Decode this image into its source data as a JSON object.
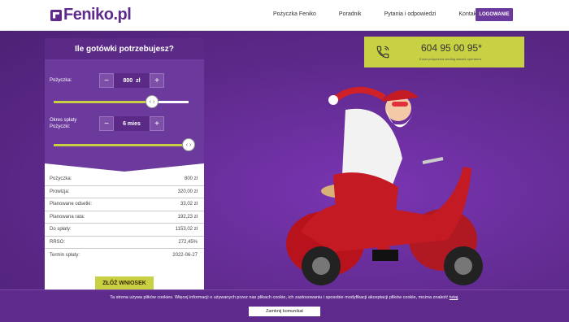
{
  "brand": {
    "logo_text": "Feniko.pl"
  },
  "nav": {
    "items": [
      "Pożyczka Feniko",
      "Poradnik",
      "Pytania i odpowiedzi",
      "Kontakt"
    ],
    "login_label": "LOGOWANIE"
  },
  "calculator": {
    "title": "Ile gotówki potrzebujesz?",
    "loan": {
      "label": "Pożyczka:",
      "value": "800",
      "unit": "zł",
      "slider_fraction": 0.73
    },
    "term": {
      "label": "Okres spłaty Pożyczki:",
      "value": "6 mies",
      "slider_fraction": 1.0
    },
    "minus": "−",
    "plus": "+",
    "knob_glyph": "‹ ›",
    "details": [
      {
        "label": "Pożyczka:",
        "value": "800 zł"
      },
      {
        "label": "Prowizja:",
        "value": "320,00 zł"
      },
      {
        "label": "Planowane odsetki:",
        "value": "33,02 zł"
      },
      {
        "label": "Planowana rata:",
        "value": "192,23 zł"
      },
      {
        "label": "Do spłaty:",
        "value": "1153,02 zł"
      },
      {
        "label": "RRSO:",
        "value": "272,45%"
      },
      {
        "label": "Termin spłaty:",
        "value": "2022-06-27"
      }
    ],
    "apply_label": "ZŁÓŻ WNIOSEK"
  },
  "phone": {
    "number": "604 95 00 95*",
    "note": "Koszt połączenia według stawek operatora"
  },
  "cookie": {
    "text": "Ta strona używa plików cookies. Więcej informacji o używanych przez nas plikach cookie, ich zastosowaniu i sposobie modyfikacji akceptacji plików cookie, można znaleźć",
    "link": "tutaj",
    "close_label": "Zamknij komunikat"
  },
  "colors": {
    "purple": "#5e2a8c",
    "lime": "#c8d143"
  }
}
